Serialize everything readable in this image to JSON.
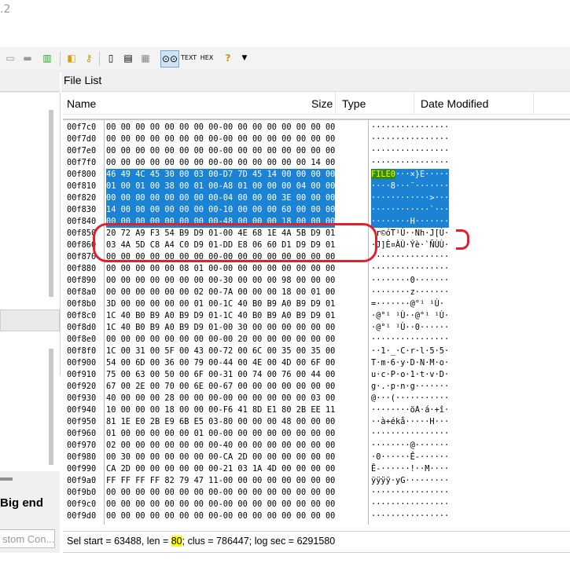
{
  "app": {
    "title_fragment": ".2"
  },
  "left_pane": {
    "big_endian_label": "Big end",
    "custom_input_placeholder": "stom Con..."
  },
  "file_list": {
    "title": "File List",
    "columns": [
      "Name",
      "Size",
      "Type",
      "Date Modified"
    ]
  },
  "hex_rows": [
    {
      "offset": "00f7c0",
      "hex": "00 00 00 00 00 00 00 00-00 00 00 00 00 00 00 00",
      "ascii": "················",
      "sel": false
    },
    {
      "offset": "00f7d0",
      "hex": "00 00 00 00 00 00 00 00-00 00 00 00 00 00 00 00",
      "ascii": "················",
      "sel": false
    },
    {
      "offset": "00f7e0",
      "hex": "00 00 00 00 00 00 00 00-00 00 00 00 00 00 00 00",
      "ascii": "················",
      "sel": false
    },
    {
      "offset": "00f7f0",
      "hex": "00 00 00 00 00 00 00 00-00 00 00 00 00 00 14 00",
      "ascii": "················",
      "sel": false
    },
    {
      "offset": "00f800",
      "hex": "46 49 4C 45 30 00 03 00-D7 7D 45 14 00 00 00 00",
      "ascii": "FILE0···×}E·····",
      "sel": true
    },
    {
      "offset": "00f810",
      "hex": "01 00 01 00 38 00 01 00-A8 01 00 00 00 04 00 00",
      "ascii": "····8···¨·······",
      "sel": true
    },
    {
      "offset": "00f820",
      "hex": "00 00 00 00 00 00 00 00-04 00 00 00 3E 00 00 00",
      "ascii": "············>···",
      "sel": true
    },
    {
      "offset": "00f830",
      "hex": "14 00 00 00 00 00 00 00-10 00 00 00 60 00 00 00",
      "ascii": "············`···",
      "sel": true
    },
    {
      "offset": "00f840",
      "hex": "00 00 00 00 00 00 00 00-48 00 00 00 18 00 00 00",
      "ascii": "········H·······",
      "sel": true
    },
    {
      "offset": "00f850",
      "hex": "20 72 A9 F3 54 B9 D9 01-00 4E 68 1E 4A 5B D9 01",
      "ascii": " r©óT¹Ù··Nh·J[Ù·",
      "sel": false
    },
    {
      "offset": "00f860",
      "hex": "03 4A 5D C8 A4 C0 D9 01-DD E8 06 60 D1 D9 D9 01",
      "ascii": "·J]È¤ÀÙ·Ýè·`ÑÙÙ·",
      "sel": false
    },
    {
      "offset": "00f870",
      "hex": "00 00 00 00 00 00 00 00-00 00 00 00 00 00 00 00",
      "ascii": "················",
      "sel": false
    },
    {
      "offset": "00f880",
      "hex": "00 00 00 00 00 08 01 00-00 00 00 00 00 00 00 00",
      "ascii": "················",
      "sel": false
    },
    {
      "offset": "00f890",
      "hex": "00 00 00 00 00 00 00 00-30 00 00 00 98 00 00 00",
      "ascii": "········0·······",
      "sel": false
    },
    {
      "offset": "00f8a0",
      "hex": "00 00 00 00 00 00 02 00-7A 00 00 00 18 00 01 00",
      "ascii": "········z·······",
      "sel": false
    },
    {
      "offset": "00f8b0",
      "hex": "3D 00 00 00 00 00 01 00-1C 40 B0 B9 A0 B9 D9 01",
      "ascii": "=·······@°¹ ¹Ù·",
      "sel": false
    },
    {
      "offset": "00f8c0",
      "hex": "1C 40 B0 B9 A0 B9 D9 01-1C 40 B0 B9 A0 B9 D9 01",
      "ascii": "·@°¹ ¹Ù··@°¹ ¹Ù·",
      "sel": false
    },
    {
      "offset": "00f8d0",
      "hex": "1C 40 B0 B9 A0 B9 D9 01-00 30 00 00 00 00 00 00",
      "ascii": "·@°¹ ¹Ù··0······",
      "sel": false
    },
    {
      "offset": "00f8e0",
      "hex": "00 00 00 00 00 00 00 00-00 20 00 00 00 00 00 00",
      "ascii": "················",
      "sel": false
    },
    {
      "offset": "00f8f0",
      "hex": "1C 00 31 00 5F 00 43 00-72 00 6C 00 35 00 35 00",
      "ascii": "··1·_·C·r·l·5·5·",
      "sel": false
    },
    {
      "offset": "00f900",
      "hex": "54 00 6D 00 36 00 79 00-44 00 4E 00 4D 00 6F 00",
      "ascii": "T·m·6·y·D·N·M·o·",
      "sel": false
    },
    {
      "offset": "00f910",
      "hex": "75 00 63 00 50 00 6F 00-31 00 74 00 76 00 44 00",
      "ascii": "u·c·P·o·1·t·v·D·",
      "sel": false
    },
    {
      "offset": "00f920",
      "hex": "67 00 2E 00 70 00 6E 00-67 00 00 00 00 00 00 00",
      "ascii": "g·.·p·n·g·······",
      "sel": false
    },
    {
      "offset": "00f930",
      "hex": "40 00 00 00 28 00 00 00-00 00 00 00 00 00 03 00",
      "ascii": "@···(···········",
      "sel": false
    },
    {
      "offset": "00f940",
      "hex": "10 00 00 00 18 00 00 00-F6 41 8D E1 80 2B EE 11",
      "ascii": "········öA·á·+î·",
      "sel": false
    },
    {
      "offset": "00f950",
      "hex": "81 1E E0 2B E9 6B E5 03-80 00 00 00 48 00 00 00",
      "ascii": "··à+ékå·····H···",
      "sel": false
    },
    {
      "offset": "00f960",
      "hex": "01 00 00 00 00 00 01 00-00 00 00 00 00 00 00 00",
      "ascii": "················",
      "sel": false
    },
    {
      "offset": "00f970",
      "hex": "02 00 00 00 00 00 00 00-40 00 00 00 00 00 00 00",
      "ascii": "········@·······",
      "sel": false
    },
    {
      "offset": "00f980",
      "hex": "00 30 00 00 00 00 00 00-CA 2D 00 00 00 00 00 00",
      "ascii": "·0······Ê-······",
      "sel": false
    },
    {
      "offset": "00f990",
      "hex": "CA 2D 00 00 00 00 00 00-21 03 1A 4D 00 00 00 00",
      "ascii": "Ê-······!··M····",
      "sel": false
    },
    {
      "offset": "00f9a0",
      "hex": "FF FF FF FF 82 79 47 11-00 00 00 00 00 00 00 00",
      "ascii": "ÿÿÿÿ·yG·········",
      "sel": false
    },
    {
      "offset": "00f9b0",
      "hex": "00 00 00 00 00 00 00 00-00 00 00 00 00 00 00 00",
      "ascii": "················",
      "sel": false
    },
    {
      "offset": "00f9c0",
      "hex": "00 00 00 00 00 00 00 00-00 00 00 00 00 00 00 00",
      "ascii": "················",
      "sel": false
    },
    {
      "offset": "00f9d0",
      "hex": "00 00 00 00 00 00 00 00-00 00 00 00 00 00 00 00",
      "ascii": "················",
      "sel": false
    }
  ],
  "status": {
    "prefix": "Sel start = 63488, len = ",
    "len_value": "80",
    "suffix": "; clus = 786447; log sec = 6291580"
  },
  "colors": {
    "selection": "#1c82d4",
    "annotation": "#e0202a",
    "highlight": "#ffff00"
  }
}
